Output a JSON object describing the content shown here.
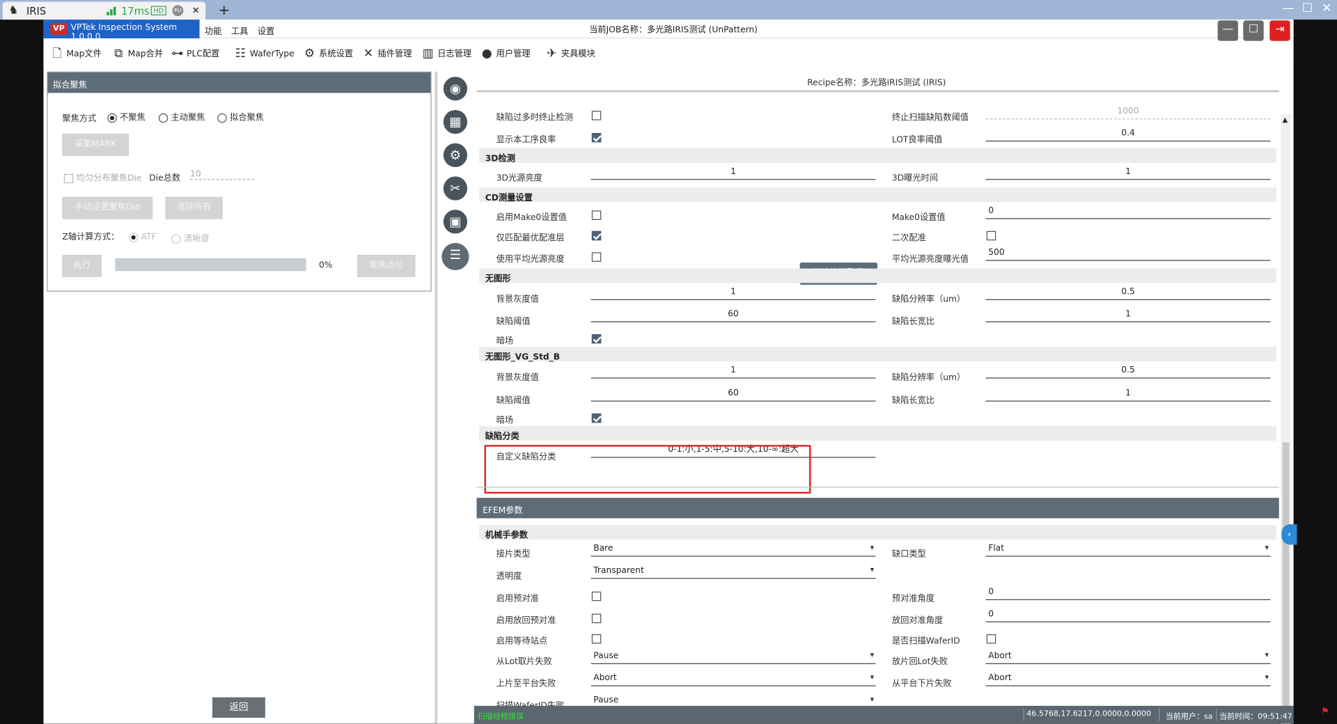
{
  "browser": {
    "tab_title": "IRIS",
    "latency": "17ms",
    "hd_badge": "HD",
    "ru_badge": "RU",
    "close_glyph": "✕",
    "new_tab_glyph": "+",
    "window_controls": {
      "minimize": "—",
      "maximize": "☐",
      "close": "✕"
    }
  },
  "app": {
    "brand": "VPTek Inspection System 1.0.0.0",
    "logo_text": "VP",
    "menus": [
      "功能",
      "工具",
      "设置"
    ],
    "job_title": "当前JOB名称：多光路IRIS测试 (UnPattern)",
    "window_buttons": {
      "min": "—",
      "max": "☐",
      "exit": "⇥"
    },
    "toolbar": [
      "Map文件",
      "Map合并",
      "PLC配置",
      "WaferType",
      "系统设置",
      "插件管理",
      "日志管理",
      "用户管理",
      "夹具模块"
    ]
  },
  "left_panel": {
    "title": "拟合聚焦",
    "focus_mode_label": "聚焦方式",
    "focus_options": [
      "不聚焦",
      "主动聚焦",
      "拟合聚焦"
    ],
    "focus_selected": 0,
    "collect_mark_btn": "采集MARK",
    "uniform_label": "均匀分布聚焦Die",
    "die_total_label": "Die总数",
    "die_total_value": "10",
    "manual_btn": "手动设置聚焦Die",
    "clear_btn": "清除所有",
    "z_calc_label": "Z轴计算方式：",
    "z_options": [
      "ATF",
      "清晰度"
    ],
    "run_btn": "执行",
    "progress_text": "0%",
    "progress_value": 0,
    "focus_point_btn": "聚焦点位",
    "return_btn": "返回"
  },
  "rail_icons": [
    "camera-icon",
    "grid-wafer-icon",
    "wafer-settings-icon",
    "tools-icon",
    "image-icon",
    "checklist-icon"
  ],
  "rail_glyphs": [
    "◉",
    "▦",
    "⚙",
    "✂",
    "▣",
    "☰"
  ],
  "recipe_title": "Recipe名称：多光路IRIS测试 (IRIS)",
  "recipe": {
    "top_rows": [
      {
        "l_label": "缺陷过多时终止检测",
        "l_check": false,
        "r_label": "终止扫描缺陷数阈值",
        "r_value": "1000"
      },
      {
        "l_label": "显示本工序良率",
        "l_check": true,
        "r_label": "LOT良率阈值",
        "r_value": "0.4"
      }
    ],
    "sec_3d": "3D检测",
    "r3d": {
      "l_label": "3D光源亮度",
      "l_value": "1",
      "r_label": "3D曝光时间",
      "r_value": "1"
    },
    "sec_cd": "CD测量设置",
    "cd_rows": [
      {
        "l_label": "启用Make0设置值",
        "l_check": false,
        "r_label": "Make0设置值",
        "r_value": "0"
      },
      {
        "l_label": "仅匹配最优配准层",
        "l_check": true,
        "r_label": "二次配准",
        "r_check": false
      },
      {
        "l_label": "使用平均光源亮度",
        "l_check": false,
        "r_label": "平均光源亮度曝光值",
        "r_value": "500"
      }
    ],
    "avg_btn": "平均光源配置",
    "sec_nopattern": "无图形",
    "np": {
      "bg_label": "背景灰度值",
      "bg_value": "1",
      "res_label": "缺陷分辨率（um）",
      "res_value": "0.5",
      "thr_label": "缺陷阈值",
      "thr_value": "60",
      "ratio_label": "缺陷长宽比",
      "ratio_value": "1",
      "dark_label": "暗场",
      "dark_check": true
    },
    "sec_np_vg": "无图形_VG_Std_B",
    "np2": {
      "bg_label": "背景灰度值",
      "bg_value": "1",
      "res_label": "缺陷分辨率（um）",
      "res_value": "0.5",
      "thr_label": "缺陷阈值",
      "thr_value": "60",
      "ratio_label": "缺陷长宽比",
      "ratio_value": "1",
      "dark_label": "暗场",
      "dark_check": true
    },
    "sec_defect_class": "缺陷分类",
    "custom_label": "自定义缺陷分类",
    "custom_value": "0-1:小,1-5:中,5-10:大,10-∞:超大"
  },
  "efem": {
    "title": "EFEM参数",
    "sec_robot": "机械手参数",
    "rows": [
      {
        "l_label": "接片类型",
        "l_sel": "Bare",
        "r_label": "缺口类型",
        "r_sel": "Flat"
      },
      {
        "l_label": "透明度",
        "l_sel": "Transparent"
      },
      {
        "l_label": "启用预对准",
        "l_check": false,
        "r_label": "预对准角度",
        "r_value": "0"
      },
      {
        "l_label": "启用放回预对准",
        "l_check": false,
        "r_label": "放回对准角度",
        "r_value": "0"
      },
      {
        "l_label": "启用等待站点",
        "l_check": false,
        "r_label": "是否扫描WaferID",
        "r_check": false
      },
      {
        "l_label": "从Lot取片失败",
        "l_sel": "Pause",
        "r_label": "放片回Lot失败",
        "r_sel": "Abort"
      },
      {
        "l_label": "上片至平台失败",
        "l_sel": "Abort",
        "r_label": "从平台下片失败",
        "r_sel": "Abort"
      },
      {
        "l_label": "扫描WaferID失败",
        "l_sel": "Pause"
      }
    ]
  },
  "status": {
    "left": "扫描线程错误",
    "coords": "46.5768,17.6217,0.0000,0.0000",
    "user": "当前用户：sa",
    "time": "当前时间：09:51:47"
  },
  "colors": {
    "accent": "#1f63c6",
    "panel_header": "#5e6c78",
    "highlight": "#e02424",
    "status_green": "#2ee82e"
  }
}
